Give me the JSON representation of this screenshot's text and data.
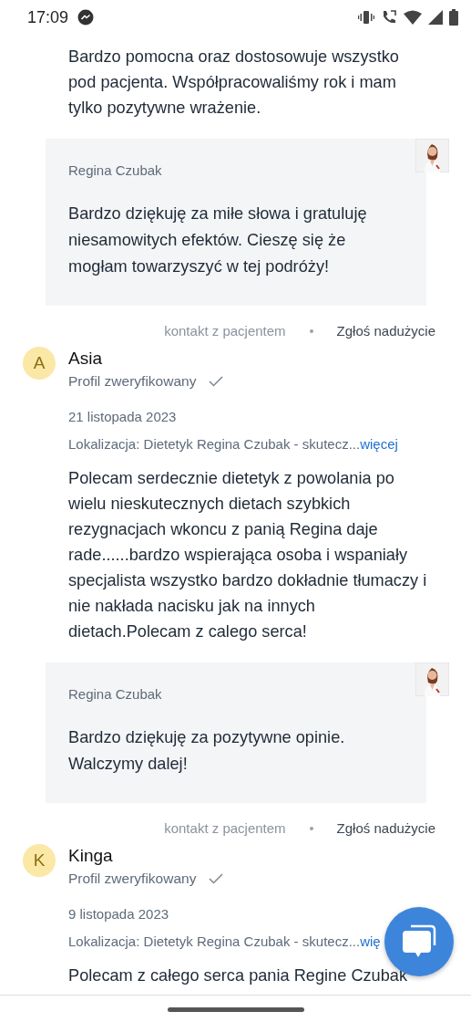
{
  "status_bar": {
    "time": "17:09"
  },
  "reviews": [
    {
      "text": "Bardzo pomocna oraz dostosowuje wszystko pod pacjenta. Współpracowaliśmy rok i mam tylko pozytywne wrażenie.",
      "reply": {
        "author": "Regina Czubak",
        "text": "Bardzo dziękuję za miłe słowa i gratuluję niesamowitych efektów. Cieszę się że mogłam towarzyszyć w tej podróży!"
      },
      "actions": {
        "contact": "kontakt z pacjentem",
        "report": "Zgłoś nadużycie"
      }
    },
    {
      "initial": "A",
      "name": "Asia",
      "verified": true,
      "verified_label": "Profil zweryfikowany",
      "date": "21 listopada 2023",
      "location": "Lokalizacja: Dietetyk Regina Czubak - skutecz...",
      "more": "więcej",
      "text": "Polecam serdecznie dietetyk z powolania po wielu nieskutecznych dietach szybkich rezygnacjach wkoncu z panią Regina daje rade......bardzo wspierająca osoba i wspaniały specjalista wszystko bardzo dokładnie tłumaczy i nie nakłada nacisku jak na innych dietach.Polecam z calego serca!",
      "reply": {
        "author": "Regina Czubak",
        "text": "Bardzo dziękuję za pozytywne opinie. Walczymy dalej!"
      },
      "actions": {
        "contact": "kontakt z pacjentem",
        "report": "Zgłoś nadużycie"
      }
    },
    {
      "initial": "K",
      "name": "Kinga",
      "verified": true,
      "verified_label": "Profil zweryfikowany",
      "date": "9 listopada 2023",
      "location": "Lokalizacja: Dietetyk Regina Czubak - skutecz...",
      "more": "wię",
      "text": "Polecam z całego serca pania Regine Czubak"
    }
  ]
}
